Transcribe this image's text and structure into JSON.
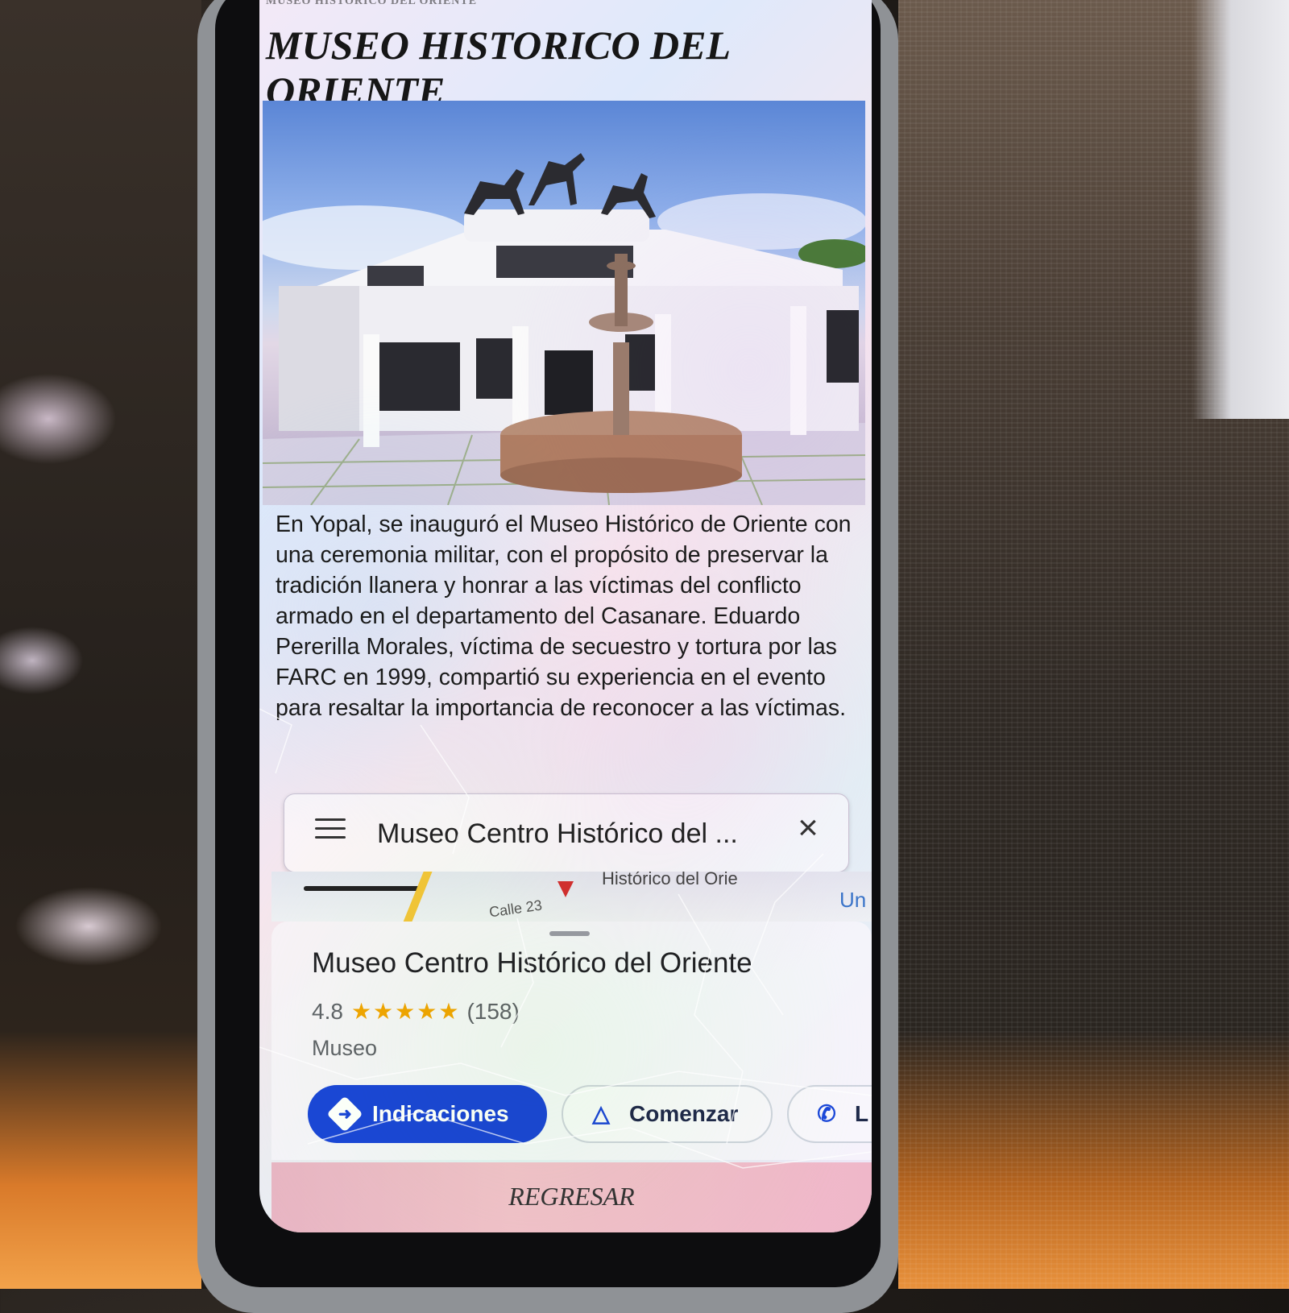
{
  "page": {
    "header_top": "MUSEO HISTORICO DEL ORIENTE",
    "title": "MUSEO HISTORICO DEL ORIENTE",
    "description": "En Yopal, se inauguró el Museo Histórico de Oriente con una ceremonia militar, con el propósito de preservar la tradición llanera y honrar a las víctimas del conflicto armado en el departamento del Casanare. Eduardo Pererilla Morales, víctima de secuestro y tortura por las FARC en 1999, compartió su experiencia en el evento para resaltar la importancia de reconocer a las víctimas.",
    "photo_icon": "museum-building-photo"
  },
  "maps": {
    "search_text": "Museo Centro Histórico del ...",
    "menu_icon": "hamburger-menu-icon",
    "close_icon": "close-icon",
    "map_label": "Histórico del Orie",
    "street_label": "Calle 23",
    "map_corner_label": "Un",
    "place": {
      "name": "Museo Centro Histórico del Oriente",
      "rating": "4.8",
      "stars": "★★★★★",
      "reviews": "(158)",
      "category": "Museo"
    },
    "actions": {
      "directions_label": "Indicaciones",
      "start_label": "Comenzar",
      "call_label": "L"
    }
  },
  "footer": {
    "back_label": "REGRESAR"
  },
  "colors": {
    "primary_button": "#1a47d9",
    "star": "#f2a400",
    "back_bar": "#f3c1cd"
  }
}
